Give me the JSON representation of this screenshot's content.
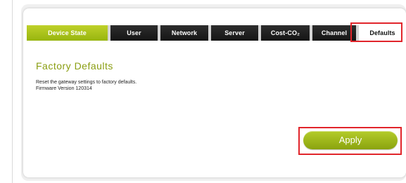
{
  "tabs": [
    {
      "label": "Device State"
    },
    {
      "label": "User"
    },
    {
      "label": "Network"
    },
    {
      "label": "Server"
    },
    {
      "label": "Cost-CO₂"
    },
    {
      "label": "Channel"
    },
    {
      "label": "Defaults"
    }
  ],
  "main": {
    "title": "Factory Defaults",
    "description_line1": "Reset the gateway settings to factory defaults.",
    "firmware_line": "Firmware Version  120314",
    "apply_label": "Apply"
  },
  "colors": {
    "accent": "#9ab812",
    "tab_dark": "#1f1f1f",
    "highlight": "#e1252b"
  }
}
